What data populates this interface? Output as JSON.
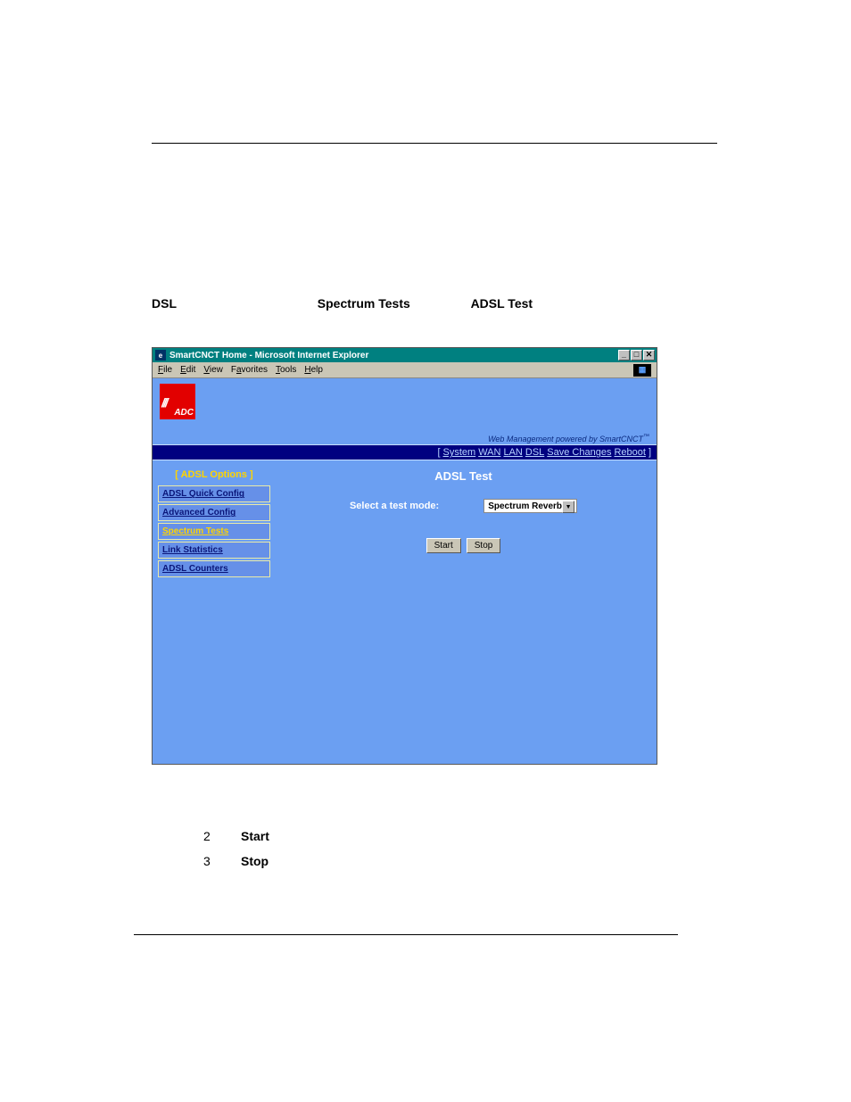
{
  "intro": {
    "prefix_bold": "DSL",
    "mid_bold": "Spectrum Tests",
    "end_bold": "ADSL Test"
  },
  "browser": {
    "title": "SmartCNCT Home - Microsoft Internet Explorer",
    "menus": [
      "File",
      "Edit",
      "View",
      "Favorites",
      "Tools",
      "Help"
    ],
    "winbtns": [
      "_",
      "□",
      "✕"
    ],
    "logo_bars": "///",
    "logo_text": "ADC",
    "powered": "Web Management powered by SmartCNCT",
    "nav": {
      "items": [
        "System",
        "WAN",
        "LAN",
        "DSL",
        "Save Changes",
        "Reboot"
      ]
    },
    "sidebar": {
      "title": "[ ADSL Options ]",
      "items": [
        {
          "label": "ADSL Quick Config",
          "active": false
        },
        {
          "label": "Advanced Config",
          "active": false
        },
        {
          "label": "Spectrum Tests",
          "active": true
        },
        {
          "label": "Link Statistics",
          "active": false
        },
        {
          "label": "ADSL Counters",
          "active": false
        }
      ]
    },
    "main": {
      "title": "ADSL Test",
      "label": "Select a test mode:",
      "dropdown_value": "Spectrum Reverb",
      "start": "Start",
      "stop": "Stop"
    }
  },
  "steps": {
    "s2": {
      "num": "2",
      "bold": "Start"
    },
    "s3": {
      "num": "3",
      "bold": "Stop"
    }
  }
}
